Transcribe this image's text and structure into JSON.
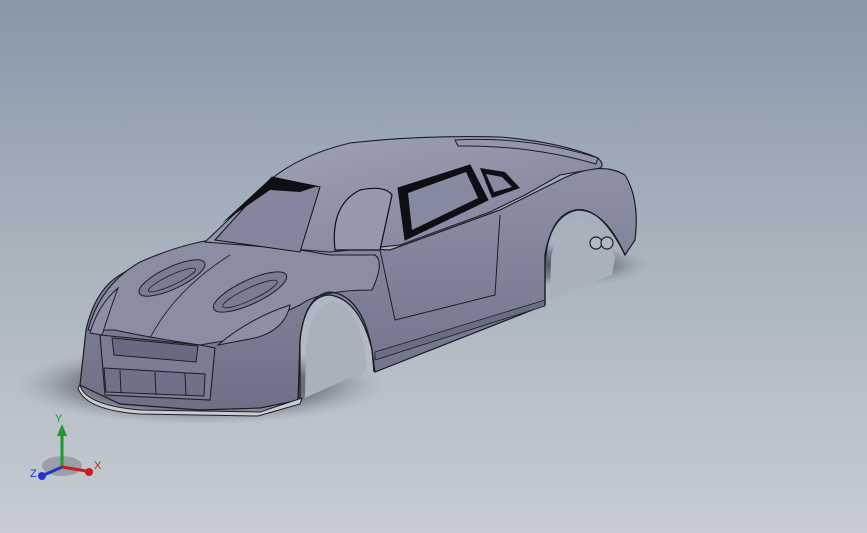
{
  "viewport": {
    "background_top": "#8997a8",
    "background_bottom": "#c7ccd2",
    "model_color": "#7c7e95"
  },
  "triad": {
    "x_label": "X",
    "y_label": "Y",
    "z_label": "Z",
    "x_color": "#c81e1e",
    "y_color": "#1c9a2d",
    "z_color": "#1f36c8"
  }
}
